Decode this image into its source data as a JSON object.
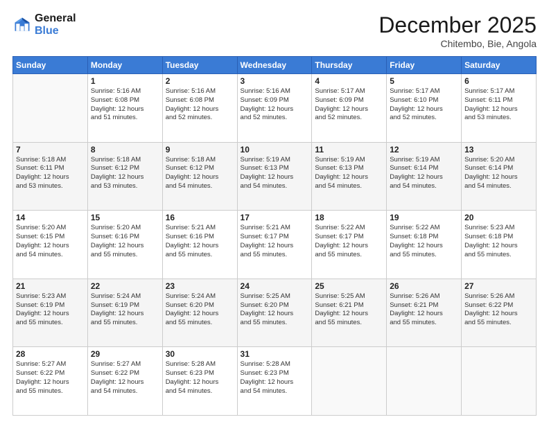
{
  "logo": {
    "line1": "General",
    "line2": "Blue"
  },
  "header": {
    "month": "December 2025",
    "location": "Chitembo, Bie, Angola"
  },
  "weekdays": [
    "Sunday",
    "Monday",
    "Tuesday",
    "Wednesday",
    "Thursday",
    "Friday",
    "Saturday"
  ],
  "weeks": [
    [
      {
        "day": "",
        "info": ""
      },
      {
        "day": "1",
        "info": "Sunrise: 5:16 AM\nSunset: 6:08 PM\nDaylight: 12 hours\nand 51 minutes."
      },
      {
        "day": "2",
        "info": "Sunrise: 5:16 AM\nSunset: 6:08 PM\nDaylight: 12 hours\nand 52 minutes."
      },
      {
        "day": "3",
        "info": "Sunrise: 5:16 AM\nSunset: 6:09 PM\nDaylight: 12 hours\nand 52 minutes."
      },
      {
        "day": "4",
        "info": "Sunrise: 5:17 AM\nSunset: 6:09 PM\nDaylight: 12 hours\nand 52 minutes."
      },
      {
        "day": "5",
        "info": "Sunrise: 5:17 AM\nSunset: 6:10 PM\nDaylight: 12 hours\nand 52 minutes."
      },
      {
        "day": "6",
        "info": "Sunrise: 5:17 AM\nSunset: 6:11 PM\nDaylight: 12 hours\nand 53 minutes."
      }
    ],
    [
      {
        "day": "7",
        "info": "Sunrise: 5:18 AM\nSunset: 6:11 PM\nDaylight: 12 hours\nand 53 minutes."
      },
      {
        "day": "8",
        "info": "Sunrise: 5:18 AM\nSunset: 6:12 PM\nDaylight: 12 hours\nand 53 minutes."
      },
      {
        "day": "9",
        "info": "Sunrise: 5:18 AM\nSunset: 6:12 PM\nDaylight: 12 hours\nand 54 minutes."
      },
      {
        "day": "10",
        "info": "Sunrise: 5:19 AM\nSunset: 6:13 PM\nDaylight: 12 hours\nand 54 minutes."
      },
      {
        "day": "11",
        "info": "Sunrise: 5:19 AM\nSunset: 6:13 PM\nDaylight: 12 hours\nand 54 minutes."
      },
      {
        "day": "12",
        "info": "Sunrise: 5:19 AM\nSunset: 6:14 PM\nDaylight: 12 hours\nand 54 minutes."
      },
      {
        "day": "13",
        "info": "Sunrise: 5:20 AM\nSunset: 6:14 PM\nDaylight: 12 hours\nand 54 minutes."
      }
    ],
    [
      {
        "day": "14",
        "info": "Sunrise: 5:20 AM\nSunset: 6:15 PM\nDaylight: 12 hours\nand 54 minutes."
      },
      {
        "day": "15",
        "info": "Sunrise: 5:20 AM\nSunset: 6:16 PM\nDaylight: 12 hours\nand 55 minutes."
      },
      {
        "day": "16",
        "info": "Sunrise: 5:21 AM\nSunset: 6:16 PM\nDaylight: 12 hours\nand 55 minutes."
      },
      {
        "day": "17",
        "info": "Sunrise: 5:21 AM\nSunset: 6:17 PM\nDaylight: 12 hours\nand 55 minutes."
      },
      {
        "day": "18",
        "info": "Sunrise: 5:22 AM\nSunset: 6:17 PM\nDaylight: 12 hours\nand 55 minutes."
      },
      {
        "day": "19",
        "info": "Sunrise: 5:22 AM\nSunset: 6:18 PM\nDaylight: 12 hours\nand 55 minutes."
      },
      {
        "day": "20",
        "info": "Sunrise: 5:23 AM\nSunset: 6:18 PM\nDaylight: 12 hours\nand 55 minutes."
      }
    ],
    [
      {
        "day": "21",
        "info": "Sunrise: 5:23 AM\nSunset: 6:19 PM\nDaylight: 12 hours\nand 55 minutes."
      },
      {
        "day": "22",
        "info": "Sunrise: 5:24 AM\nSunset: 6:19 PM\nDaylight: 12 hours\nand 55 minutes."
      },
      {
        "day": "23",
        "info": "Sunrise: 5:24 AM\nSunset: 6:20 PM\nDaylight: 12 hours\nand 55 minutes."
      },
      {
        "day": "24",
        "info": "Sunrise: 5:25 AM\nSunset: 6:20 PM\nDaylight: 12 hours\nand 55 minutes."
      },
      {
        "day": "25",
        "info": "Sunrise: 5:25 AM\nSunset: 6:21 PM\nDaylight: 12 hours\nand 55 minutes."
      },
      {
        "day": "26",
        "info": "Sunrise: 5:26 AM\nSunset: 6:21 PM\nDaylight: 12 hours\nand 55 minutes."
      },
      {
        "day": "27",
        "info": "Sunrise: 5:26 AM\nSunset: 6:22 PM\nDaylight: 12 hours\nand 55 minutes."
      }
    ],
    [
      {
        "day": "28",
        "info": "Sunrise: 5:27 AM\nSunset: 6:22 PM\nDaylight: 12 hours\nand 55 minutes."
      },
      {
        "day": "29",
        "info": "Sunrise: 5:27 AM\nSunset: 6:22 PM\nDaylight: 12 hours\nand 54 minutes."
      },
      {
        "day": "30",
        "info": "Sunrise: 5:28 AM\nSunset: 6:23 PM\nDaylight: 12 hours\nand 54 minutes."
      },
      {
        "day": "31",
        "info": "Sunrise: 5:28 AM\nSunset: 6:23 PM\nDaylight: 12 hours\nand 54 minutes."
      },
      {
        "day": "",
        "info": ""
      },
      {
        "day": "",
        "info": ""
      },
      {
        "day": "",
        "info": ""
      }
    ]
  ]
}
